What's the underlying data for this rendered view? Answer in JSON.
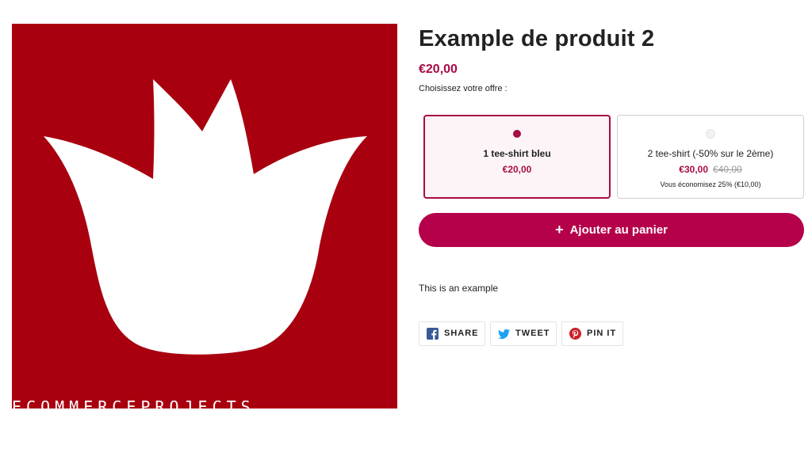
{
  "image": {
    "background_color": "#a8000f",
    "logo": "white-tulip-logo",
    "brand_text": "ECOMMERCEPROJECTS"
  },
  "product": {
    "title": "Example de produit 2",
    "price": "€20,00",
    "offer_prompt": "Choisissez votre offre :",
    "accent_color": "#a80b46"
  },
  "offers": [
    {
      "name": "1 tee-shirt bleu",
      "price": "€20,00",
      "selected": true
    },
    {
      "name": "2 tee-shirt (-50% sur le 2ème)",
      "price": "€30,00",
      "compare_price": "€40,00",
      "savings": "Vous économisez 25% (€10,00)",
      "selected": false
    }
  ],
  "cart": {
    "icon": "plus-icon",
    "label": "Ajouter au panier",
    "color": "#b5004a"
  },
  "description": "This is an example",
  "share": {
    "facebook": {
      "label": "SHARE",
      "icon": "facebook-icon",
      "color": "#3b5998"
    },
    "twitter": {
      "label": "TWEET",
      "icon": "twitter-icon",
      "color": "#1da1f2"
    },
    "pinterest": {
      "label": "PIN IT",
      "icon": "pinterest-icon",
      "color": "#cb2027"
    }
  }
}
